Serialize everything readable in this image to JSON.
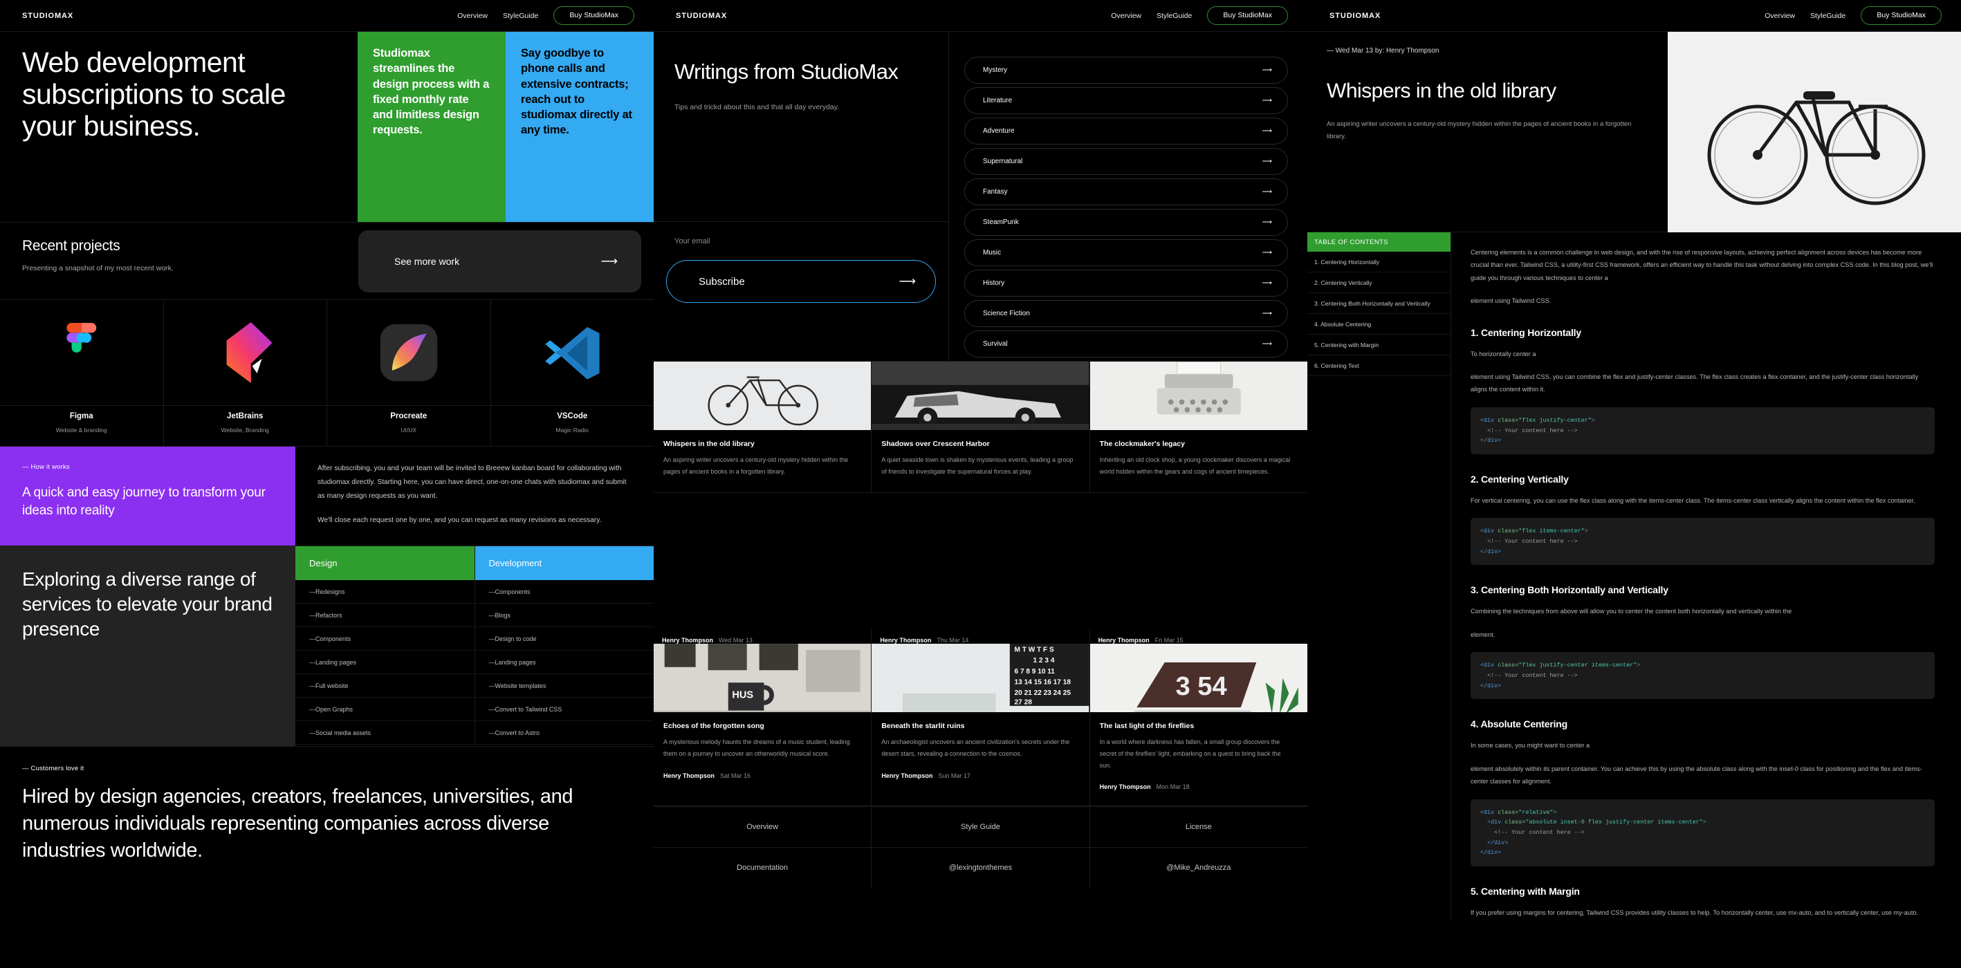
{
  "nav": {
    "brand": "STUDIOMAX",
    "links": [
      "Overview",
      "StyleGuide"
    ],
    "cta": "Buy StudioMax"
  },
  "panel1": {
    "hero": {
      "title": "Web development subscriptions to scale your business.",
      "green_card": "Studiomax streamlines the design process with a fixed monthly rate and limitless design requests.",
      "blue_card": "Say goodbye to phone calls and extensive contracts; reach out to studiomax directly at any time."
    },
    "recent": {
      "title": "Recent projects",
      "subtitle": "Presenting a snapshot of my most recent work.",
      "see_more": "See more work"
    },
    "projects": [
      {
        "name": "Figma",
        "sub": "Website & branding",
        "icon": "figma-logo"
      },
      {
        "name": "JetBrains",
        "sub": "Website, Branding",
        "icon": "jetbrains-logo"
      },
      {
        "name": "Procreate",
        "sub": "UI/UX",
        "icon": "procreate-logo"
      },
      {
        "name": "VSCode",
        "sub": "Magic Radio",
        "icon": "vscode-logo"
      }
    ],
    "how": {
      "kicker": "— How it works",
      "heading": "A quick and easy journey to transform your ideas into reality",
      "paragraph1": "After subscribing, you and your team will be invited to Breeew kanban board for collaborating with studiomax directly. Starting here, you can have direct, one-on-one chats with studiomax and submit as many design requests as you want.",
      "paragraph2": "We'll close each request one by one, and you can request as many revisions as necessary."
    },
    "services": {
      "heading": "Exploring a diverse range of services to elevate your brand presence",
      "design_label": "Design",
      "development_label": "Development",
      "design_items": [
        "—Redesigns",
        "—Refactors",
        "—Components",
        "—Landing pages",
        "—Full website",
        "—Open Graphs",
        "—Social media assets"
      ],
      "development_items": [
        "—Components",
        "—Blogs",
        "—Design to code",
        "—Landing pages",
        "—Website templates",
        "—Convert to Tailwind CSS",
        "—Convert to Astro"
      ]
    },
    "love": {
      "kicker": "— Customers love it",
      "heading": "Hired by design agencies, creators, freelances, universities, and numerous individuals representing companies across diverse industries worldwide."
    }
  },
  "panel2": {
    "title": "Writings from StudioMax",
    "subtitle": "Tips and trickd about this and that all day everyday.",
    "email_placeholder": "Your email",
    "subscribe_label": "Subscribe",
    "categories": [
      "Mystery",
      "Literature",
      "Adventure",
      "Supernatural",
      "Fantasy",
      "SteamPunk",
      "Music",
      "History",
      "Science Fiction",
      "Survival"
    ],
    "cards_row1": [
      {
        "title": "Whispers in the old library",
        "desc": "An aspiring writer uncovers a century-old mystery hidden within the pages of ancient books in a forgotten library.",
        "image": "bicycle-photo"
      },
      {
        "title": "Shadows over Crescent Harbor",
        "desc": "A quiet seaside town is shaken by mysterious events, leading a group of friends to investigate the supernatural forces at play.",
        "image": "vintage-car-photo"
      },
      {
        "title": "The clockmaker's legacy",
        "desc": "Inheriting an old clock shop, a young clockmaker discovers a magical world hidden within the gears and cogs of ancient timepieces.",
        "image": "typewriter-photo"
      }
    ],
    "cards_row2_bylines": [
      {
        "author": "Henry Thompson",
        "date": "Wed Mar 13"
      },
      {
        "author": "Henry Thompson",
        "date": "Thu Mar 14"
      },
      {
        "author": "Henry Thompson",
        "date": "Fri Mar 15"
      }
    ],
    "cards_row2": [
      {
        "title": "Echoes of the forgotten song",
        "desc": "A mysterious melody haunts the dreams of a music student, leading them on a journey to uncover an otherworldly musical score.",
        "author": "Henry Thompson",
        "date": "Sat Mar 16",
        "image": "desk-mug-photo"
      },
      {
        "title": "Beneath the starlit ruins",
        "desc": "An archaeologist uncovers an ancient civilization's secrets under the desert stars, revealing a connection to the cosmos.",
        "author": "Henry Thompson",
        "date": "Sun Mar 17",
        "image": "calendar-desk-photo"
      },
      {
        "title": "The last light of the fireflies",
        "desc": "In a world where darkness has fallen, a small group discovers the secret of the fireflies' light, embarking on a quest to bring back the sun.",
        "author": "Henry Thompson",
        "date": "Mon Mar 18",
        "image": "laptop-plant-photo"
      }
    ],
    "footer_row1": [
      "Overview",
      "Style Guide",
      "License"
    ],
    "footer_row2": [
      "Documentation",
      "@lexingtonthemes",
      "@Mike_Andreuzza"
    ]
  },
  "panel3": {
    "kicker": "— Wed Mar 13 by: Henry Thompson",
    "title": "Whispers in the old library",
    "subtitle": "An aspiring writer uncovers a century-old mystery hidden within the pages of ancient books in a forgotten library.",
    "hero_image": "bicycle-on-white-wall-photo",
    "toc_header": "TABLE OF CONTENTS",
    "toc": [
      "1. Centering Horizontally",
      "2. Centering Vertically",
      "3. Centering Both Horizontally and Vertically",
      "4. Absolute Centering",
      "5. Centering with Margin",
      "6. Centering Text"
    ],
    "intro1": "Centering elements is a common challenge in web design, and with the rise of responsive layouts, achieving perfect alignment across devices has become more crucial than ever. Tailwind CSS, a utility-first CSS framework, offers an efficient way to handle this task without delving into complex CSS code. In this blog post, we'll guide you through various techniques to center a",
    "intro2": "element using Tailwind CSS.",
    "sections": [
      {
        "heading": "1. Centering Horizontally",
        "p1": "To horizontally center a",
        "p2": "element using Tailwind CSS, you can combine the flex and justify-center classes. The flex class creates a flex container, and the justify-center class horizontally aligns the content within it.",
        "code": [
          "<div class=\"flex justify-center\">",
          "  <!-- Your content here -->",
          "</div>"
        ]
      },
      {
        "heading": "2. Centering Vertically",
        "p1": "For vertical centering, you can use the flex class along with the items-center class. The items-center class vertically aligns the content within the flex container.",
        "p2": "",
        "code": [
          "<div class=\"flex items-center\">",
          "  <!-- Your content here -->",
          "</div>"
        ]
      },
      {
        "heading": "3. Centering Both Horizontally and Vertically",
        "p1": "Combining the techniques from above will allow you to center the content both horizontally and vertically within the",
        "p2": "element.",
        "code": [
          "<div class=\"flex justify-center items-center\">",
          "  <!-- Your content here -->",
          "</div>"
        ]
      },
      {
        "heading": "4. Absolute Centering",
        "p1": "In some cases, you might want to center a",
        "p2": "element absolutely within its parent container. You can achieve this by using the absolute class along with the inset-0 class for positioning and the flex and items-center classes for alignment.",
        "code": [
          "<div class=\"relative\">",
          "  <div class=\"absolute inset-0 flex justify-center items-center\">",
          "    <!-- Your content here -->",
          "  </div>",
          "</div>"
        ]
      },
      {
        "heading": "5. Centering with Margin",
        "p1": "If you prefer using margins for centering, Tailwind CSS provides utility classes to help. To horizontally center, use mx-auto, and to vertically center, use my-auto.",
        "p2": "",
        "code": []
      }
    ]
  },
  "colors": {
    "green": "#2f9e2f",
    "blue": "#34aaf2",
    "purple": "#8b2ff0",
    "dark": "#000000",
    "panel_border": "#1b1b1b"
  }
}
